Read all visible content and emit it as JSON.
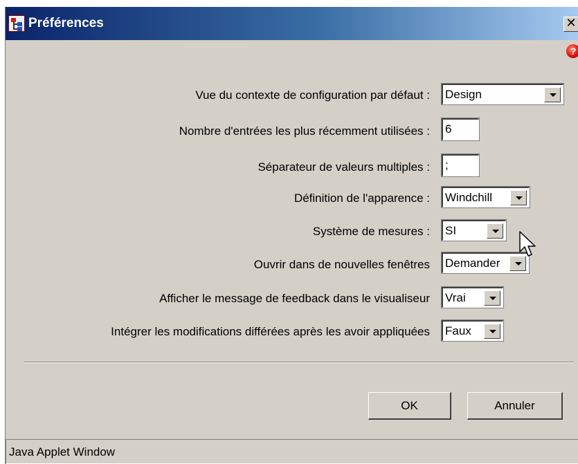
{
  "window": {
    "title": "Préférences",
    "close_glyph": "✕",
    "help_glyph": "?"
  },
  "preferences": [
    {
      "label": "Vue du contexte de configuration par défaut :",
      "value": "Design",
      "control": "select"
    },
    {
      "label": "Nombre d'entrées les plus récemment utilisées :",
      "value": "6",
      "control": "text"
    },
    {
      "label": "Séparateur de valeurs multiples :",
      "value": ";",
      "control": "text"
    },
    {
      "label": "Définition de l'apparence :",
      "value": "Windchill",
      "control": "select"
    },
    {
      "label": "Système de mesures :",
      "value": "SI",
      "control": "select"
    },
    {
      "label": "Ouvrir dans de nouvelles fenêtres",
      "value": "Demander",
      "control": "select"
    },
    {
      "label": "Afficher le message de feedback dans le visualiseur",
      "value": "Vrai",
      "control": "select"
    },
    {
      "label": "Intégrer les modifications différées après les avoir appliquées",
      "value": "Faux",
      "control": "select"
    }
  ],
  "buttons": {
    "ok": "OK",
    "cancel": "Annuler"
  },
  "status_bar": {
    "text": "Java Applet Window"
  },
  "colors": {
    "title_start": "#0a246a",
    "title_end": "#a6caf0",
    "window_bg": "#d4d0c8",
    "help_red": "#e01010"
  }
}
